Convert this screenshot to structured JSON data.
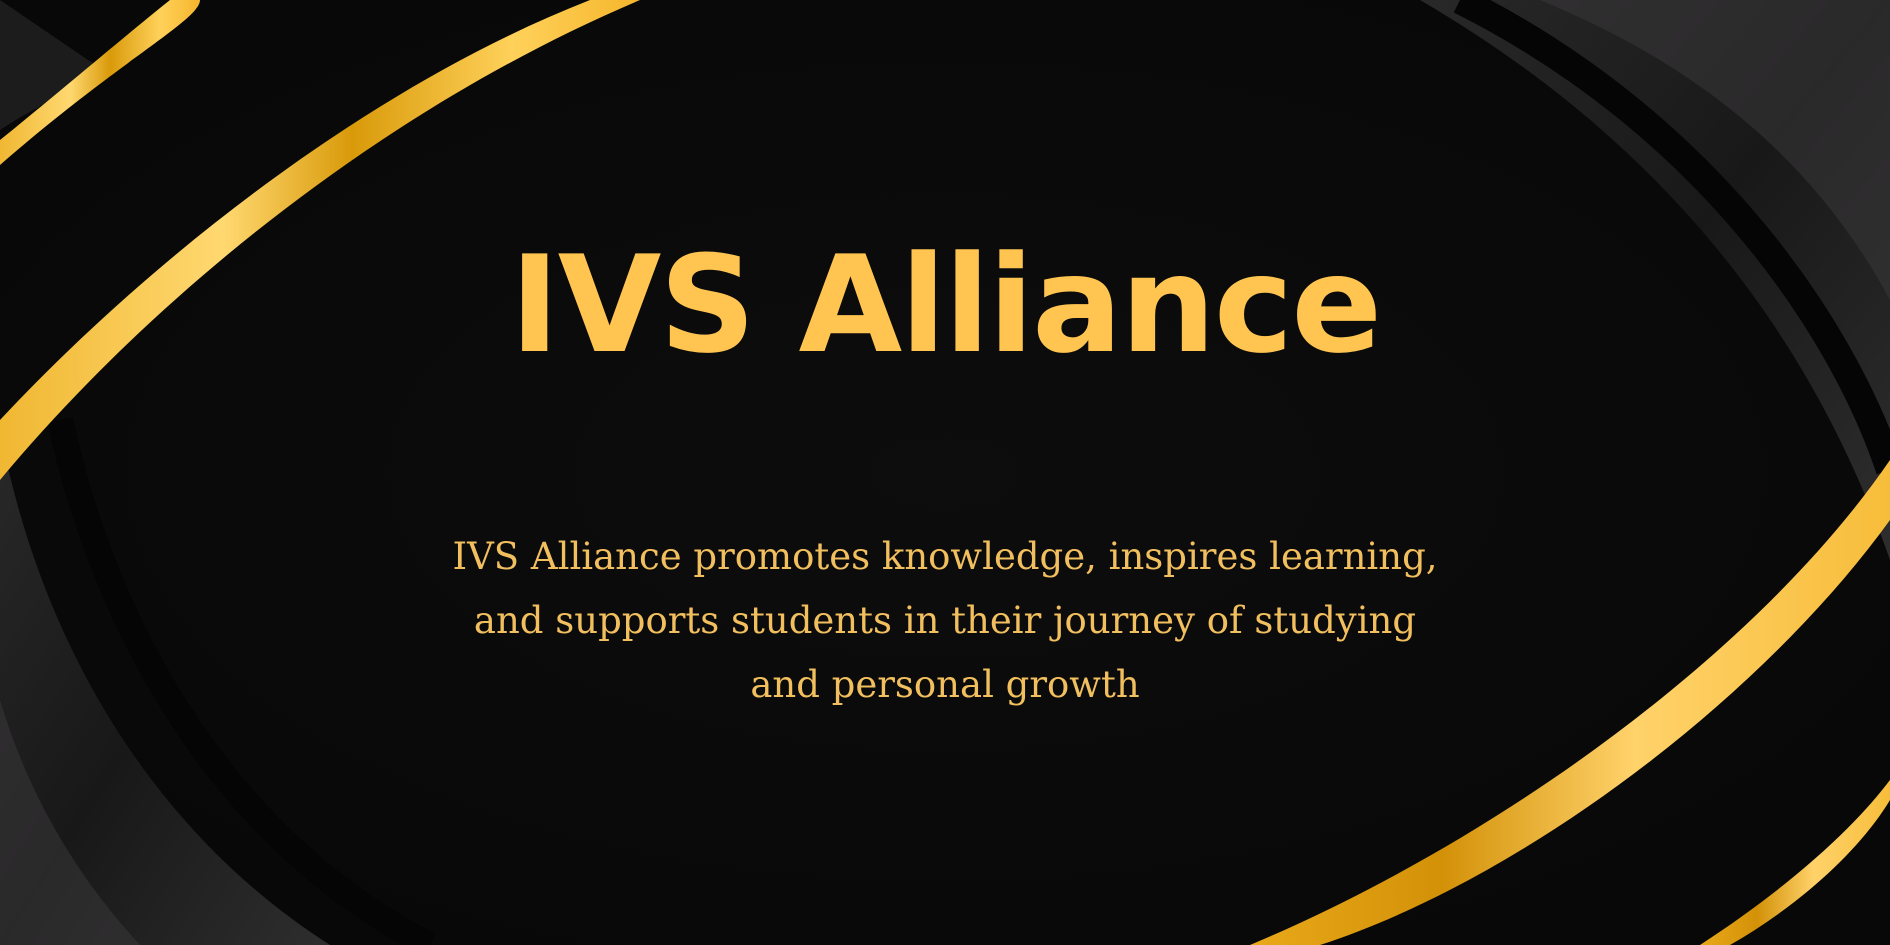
{
  "banner": {
    "title": "IVS Alliance",
    "tagline": "IVS Alliance promotes knowledge, inspires learning, and supports students in their journey of studying and personal growth"
  },
  "colors": {
    "background": "#0b0b0b",
    "gold": "#ffc550",
    "gold_dark": "#d9a00c",
    "gold_light": "#ffdb7a",
    "tagline": "#f2bf5e"
  }
}
